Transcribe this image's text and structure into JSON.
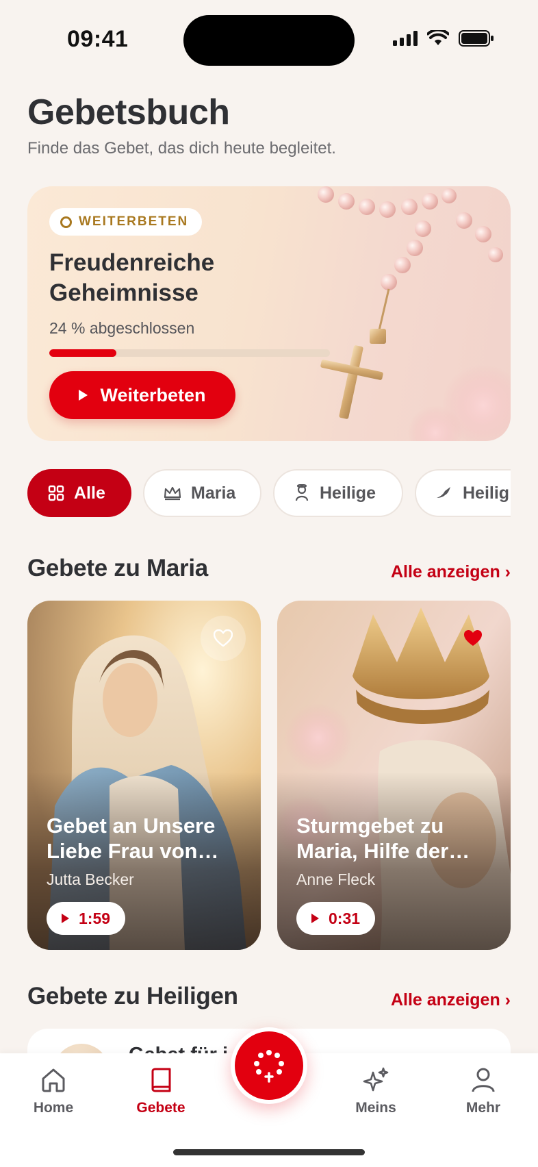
{
  "status_bar": {
    "time": "09:41"
  },
  "header": {
    "title": "Gebetsbuch",
    "subtitle": "Finde das Gebet, das dich heute begleitet."
  },
  "hero": {
    "badge": "WEITERBETEN",
    "title": "Freudenreiche Geheimnisse",
    "progress_text": "24 % abgeschlossen",
    "progress": 0.24,
    "button_label": "Weiterbeten"
  },
  "filters": [
    {
      "label": "Alle",
      "icon": "grid-icon",
      "active": true
    },
    {
      "label": "Maria",
      "icon": "crown-icon",
      "active": false
    },
    {
      "label": "Heilige",
      "icon": "person-icon",
      "active": false
    },
    {
      "label": "Heilig",
      "icon": "dove-icon",
      "active": false
    }
  ],
  "section_maria": {
    "title": "Gebete zu Maria",
    "link": "Alle anzeigen ›",
    "cards": [
      {
        "title": "Gebet an Unsere Liebe Frau von…",
        "author": "Jutta Becker",
        "duration": "1:59",
        "favorite": false
      },
      {
        "title": "Sturmgebet zu Maria, Hilfe der…",
        "author": "Anne Fleck",
        "duration": "0:31",
        "favorite": true
      }
    ]
  },
  "section_heilige": {
    "title": "Gebete zu Heiligen",
    "link": "Alle anzeigen ›",
    "first_item_title": "Gebet für i"
  },
  "bottom_nav": {
    "items": [
      {
        "label": "Home",
        "icon": "home-icon",
        "active": false
      },
      {
        "label": "Gebete",
        "icon": "book-icon",
        "active": true
      },
      {
        "label": "Meins",
        "icon": "sparkle-icon",
        "active": false
      },
      {
        "label": "Mehr",
        "icon": "person-icon",
        "active": false
      }
    ],
    "center_icon": "rosary-icon"
  },
  "colors": {
    "accent": "#e2000f",
    "accent_dark": "#c40014",
    "gold": "#a8781f",
    "background": "#f8f3ef"
  }
}
